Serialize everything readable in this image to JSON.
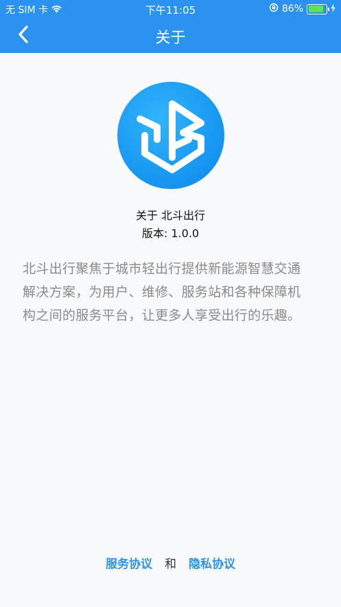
{
  "status_bar": {
    "carrier": "无 SIM 卡",
    "time": "下午11:05",
    "battery_percent": "86%",
    "battery_level": 0.86,
    "icons": [
      "wifi-icon",
      "orientation-lock-icon",
      "battery-icon",
      "charging-icon"
    ]
  },
  "nav": {
    "back_icon": "chevron-left-icon",
    "title": "关于"
  },
  "app": {
    "logo_icon": "app-logo-icon",
    "name": "关于 北斗出行",
    "version": "版本: 1.0.0"
  },
  "description": "北斗出行聚焦于城市轻出行提供新能源智慧交通解决方案，为用户、维修、服务站和各种保障机构之间的服务平台，让更多人享受出行的乐趣。",
  "footer": {
    "service_agreement": "服务协议",
    "and": "和",
    "privacy_agreement": "隐私协议"
  },
  "colors": {
    "primary": "#2b93ef",
    "background": "#f8f9fb",
    "description_text": "#8a8a8a"
  }
}
